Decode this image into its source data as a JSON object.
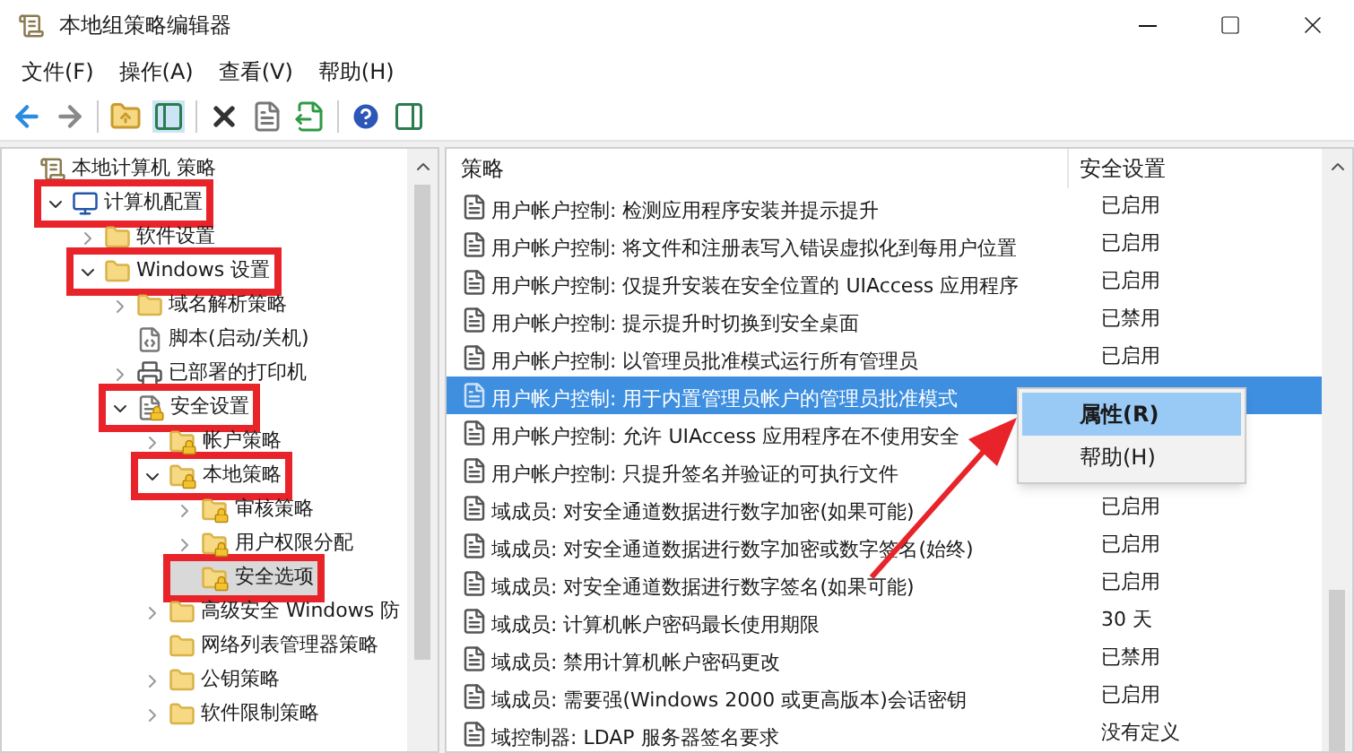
{
  "window": {
    "title": "本地组策略编辑器"
  },
  "menu": [
    "文件(F)",
    "操作(A)",
    "查看(V)",
    "帮助(H)"
  ],
  "tree": [
    {
      "label": "本地计算机 策略",
      "kind": "policy",
      "selected": false,
      "annotated": false,
      "children": [
        {
          "label": "计算机配置",
          "kind": "computer",
          "expanded": true,
          "selected": false,
          "annotated": true,
          "children": [
            {
              "label": "软件设置",
              "kind": "folder",
              "expanded": false,
              "selected": false,
              "annotated": false
            },
            {
              "label": "Windows 设置",
              "kind": "folder",
              "expanded": true,
              "selected": false,
              "annotated": true,
              "children": [
                {
                  "label": "域名解析策略",
                  "kind": "folder",
                  "expanded": false,
                  "selected": false,
                  "annotated": false
                },
                {
                  "label": "脚本(启动/关机)",
                  "kind": "script",
                  "selected": false,
                  "annotated": false
                },
                {
                  "label": "已部署的打印机",
                  "kind": "printer",
                  "expanded": false,
                  "selected": false,
                  "annotated": false
                },
                {
                  "label": "安全设置",
                  "kind": "secure-node",
                  "expanded": true,
                  "selected": false,
                  "annotated": true,
                  "children": [
                    {
                      "label": "帐户策略",
                      "kind": "secure-folder",
                      "expanded": false,
                      "selected": false,
                      "annotated": false
                    },
                    {
                      "label": "本地策略",
                      "kind": "secure-folder",
                      "expanded": true,
                      "selected": false,
                      "annotated": true,
                      "children": [
                        {
                          "label": "审核策略",
                          "kind": "secure-folder",
                          "expanded": false,
                          "selected": false,
                          "annotated": false
                        },
                        {
                          "label": "用户权限分配",
                          "kind": "secure-folder",
                          "expanded": false,
                          "selected": false,
                          "annotated": false
                        },
                        {
                          "label": "安全选项",
                          "kind": "secure-folder",
                          "selected": true,
                          "annotated": true
                        }
                      ]
                    },
                    {
                      "label": "高级安全 Windows 防",
                      "kind": "folder",
                      "expanded": false,
                      "selected": false,
                      "annotated": false
                    },
                    {
                      "label": "网络列表管理器策略",
                      "kind": "folder",
                      "selected": false,
                      "annotated": false
                    },
                    {
                      "label": "公钥策略",
                      "kind": "folder",
                      "expanded": false,
                      "selected": false,
                      "annotated": false
                    },
                    {
                      "label": "软件限制策略",
                      "kind": "folder",
                      "expanded": false,
                      "selected": false,
                      "annotated": false
                    }
                  ]
                }
              ]
            }
          ]
        }
      ]
    }
  ],
  "table": {
    "columns": [
      "策略",
      "安全设置"
    ],
    "rows": [
      {
        "policy": "用户帐户控制: 检测应用程序安装并提示提升",
        "setting": "已启用",
        "selected": false
      },
      {
        "policy": "用户帐户控制: 将文件和注册表写入错误虚拟化到每用户位置",
        "setting": "已启用",
        "selected": false
      },
      {
        "policy": "用户帐户控制: 仅提升安装在安全位置的 UIAccess 应用程序",
        "setting": "已启用",
        "selected": false
      },
      {
        "policy": "用户帐户控制: 提示提升时切换到安全桌面",
        "setting": "已禁用",
        "selected": false
      },
      {
        "policy": "用户帐户控制: 以管理员批准模式运行所有管理员",
        "setting": "已启用",
        "selected": false
      },
      {
        "policy": "用户帐户控制: 用于内置管理员帐户的管理员批准模式",
        "selected": true
      },
      {
        "policy": "用户帐户控制: 允许 UIAccess 应用程序在不使用安全",
        "selected": false
      },
      {
        "policy": "用户帐户控制: 只提升签名并验证的可执行文件",
        "selected": false
      },
      {
        "policy": "域成员: 对安全通道数据进行数字加密(如果可能)",
        "setting": "已启用",
        "selected": false
      },
      {
        "policy": "域成员: 对安全通道数据进行数字加密或数字签名(始终)",
        "setting": "已启用",
        "selected": false
      },
      {
        "policy": "域成员: 对安全通道数据进行数字签名(如果可能)",
        "setting": "已启用",
        "selected": false
      },
      {
        "policy": "域成员: 计算机帐户密码最长使用期限",
        "setting": "30 天",
        "selected": false
      },
      {
        "policy": "域成员: 禁用计算机帐户密码更改",
        "setting": "已禁用",
        "selected": false
      },
      {
        "policy": "域成员: 需要强(Windows 2000 或更高版本)会话密钥",
        "setting": "已启用",
        "selected": false
      },
      {
        "policy": "域控制器: LDAP 服务器签名要求",
        "setting": "没有定义",
        "selected": false
      }
    ]
  },
  "context_menu": [
    {
      "label": "属性(R)",
      "selected": true
    },
    {
      "label": "帮助(H)",
      "selected": false
    }
  ]
}
